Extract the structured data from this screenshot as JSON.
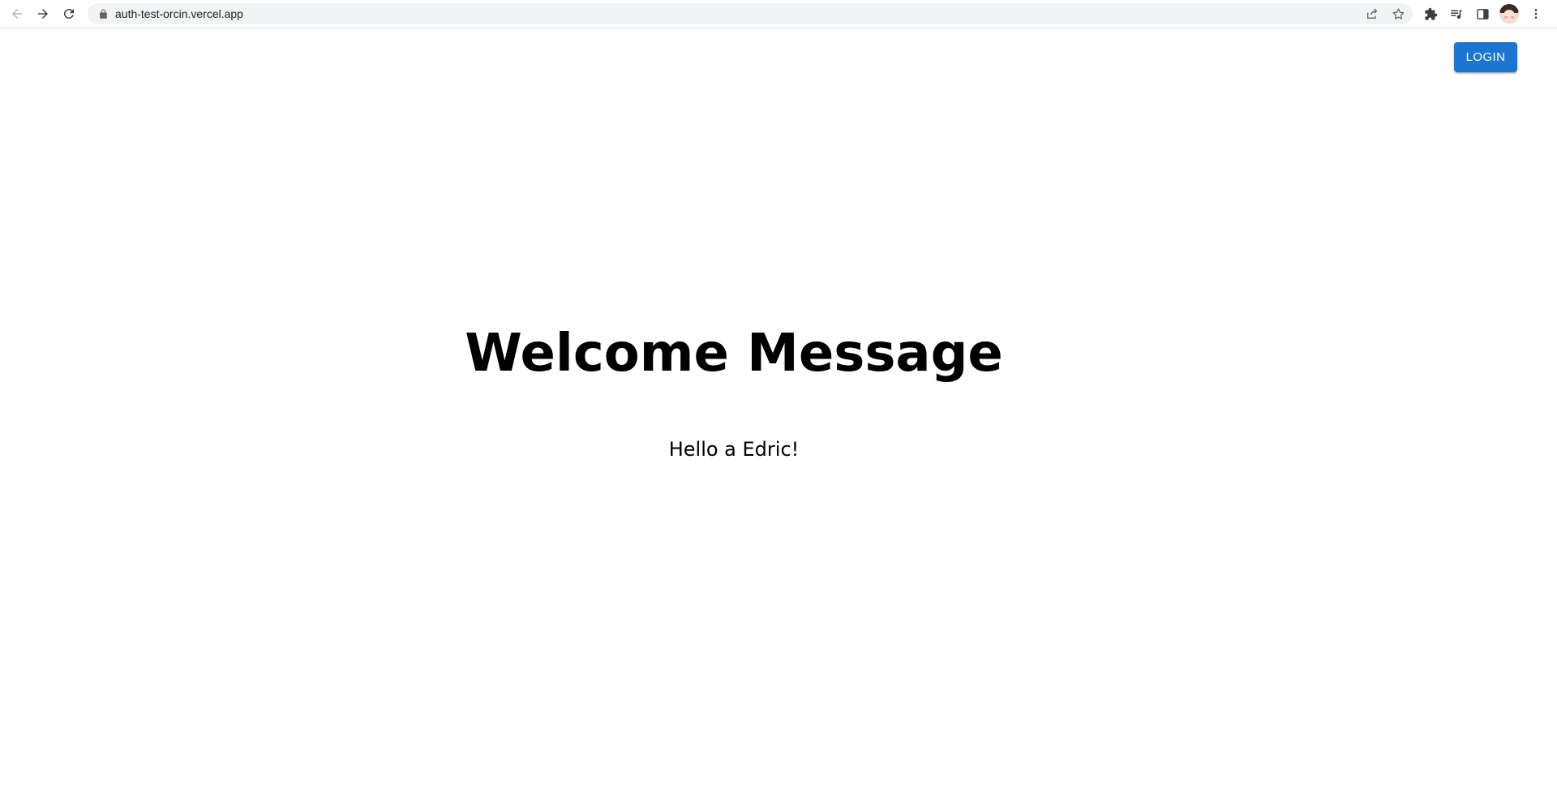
{
  "browser": {
    "url": "auth-test-orcin.vercel.app",
    "icons": {
      "back": "arrow-left-icon",
      "forward": "arrow-right-icon",
      "reload": "reload-icon",
      "lock": "lock-icon",
      "share": "share-icon",
      "bookmark": "star-icon",
      "extensions": "puzzle-icon",
      "media": "media-queue-icon",
      "side_panel": "side-panel-icon",
      "profile": "avatar",
      "menu": "kebab-menu-icon"
    }
  },
  "page": {
    "login_label": "LOGIN",
    "heading": "Welcome Message",
    "greeting": "Hello a Edric!"
  },
  "colors": {
    "accent": "#1976d2",
    "omnibox_bg": "#f1f3f4"
  }
}
